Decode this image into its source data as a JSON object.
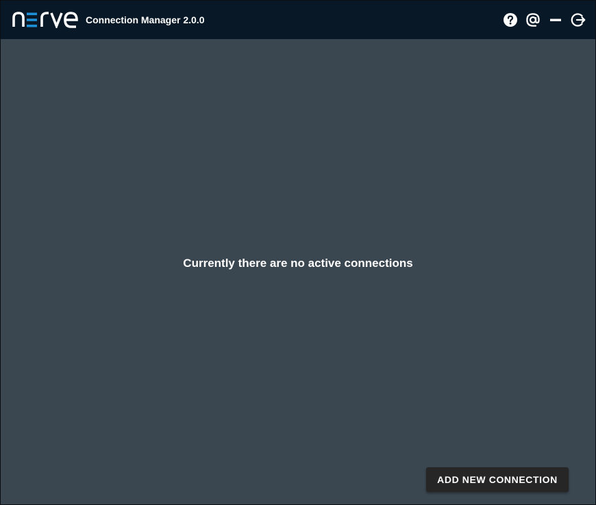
{
  "app": {
    "logo_text": "nerve",
    "title": "Connection Manager 2.0.0"
  },
  "window_controls": [
    {
      "name": "help-icon"
    },
    {
      "name": "at-icon"
    },
    {
      "name": "minimize-icon"
    },
    {
      "name": "exit-icon"
    }
  ],
  "main": {
    "empty_message": "Currently there are no active connections",
    "add_button_label": "ADD NEW CONNECTION"
  },
  "colors": {
    "titlebar_bg": "#081826",
    "content_bg": "#3a4650",
    "logo_accent": "#1e90d8",
    "button_bg": "#262626"
  }
}
